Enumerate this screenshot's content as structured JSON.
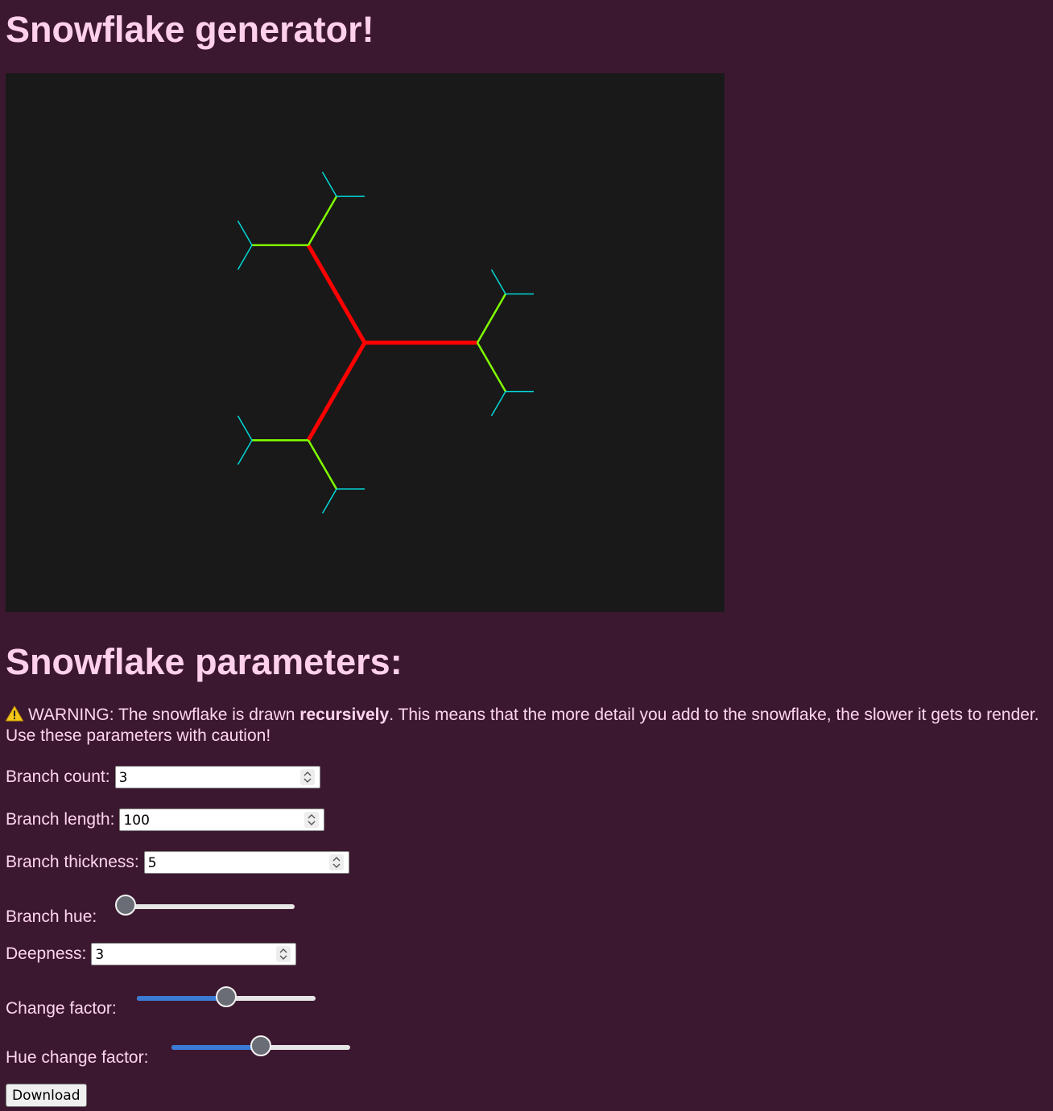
{
  "page": {
    "title": "Snowflake generator!",
    "params_title": "Snowflake parameters:",
    "background_color": "#3c1830"
  },
  "warning": {
    "icon": "warning-icon",
    "prefix": "WARNING: The snowflake is drawn ",
    "emphasis": "recursively",
    "suffix": ". This means that the more detail you add to the snowflake, the slower it gets to render. Use these parameters with caution!"
  },
  "canvas": {
    "background_color": "#191919",
    "level_colors": [
      "#ff0000",
      "#80ff00",
      "#00d8d8"
    ]
  },
  "params": {
    "branch_count": {
      "label": "Branch count:",
      "value": "3"
    },
    "branch_length": {
      "label": "Branch length:",
      "value": "100"
    },
    "branch_thickness": {
      "label": "Branch thickness:",
      "value": "5"
    },
    "branch_hue": {
      "label": "Branch hue:",
      "fraction": 0
    },
    "deepness": {
      "label": "Deepness:",
      "value": "3"
    },
    "change_factor": {
      "label": "Change factor:",
      "fraction": 0.5
    },
    "hue_change_factor": {
      "label": "Hue change factor:",
      "fraction": 0.5
    }
  },
  "download": {
    "label": "Download"
  }
}
